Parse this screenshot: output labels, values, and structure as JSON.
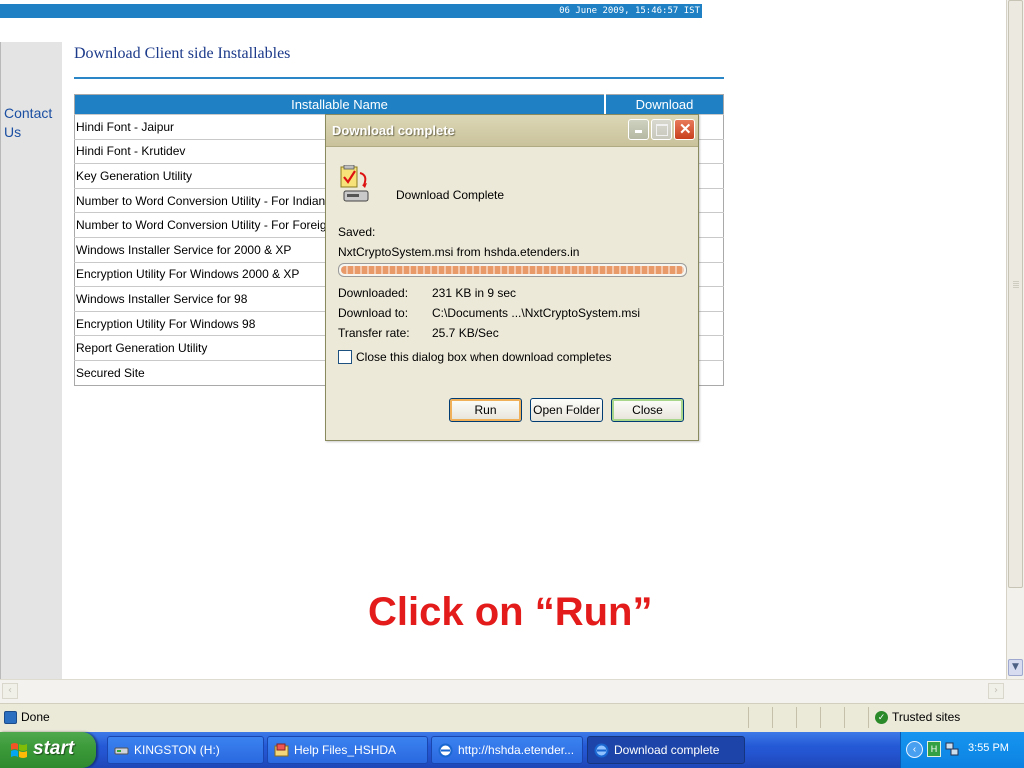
{
  "header": {
    "datetime": "06 June 2009,  15:46:57  IST"
  },
  "sidebar": {
    "contact_link": "Contact Us"
  },
  "page": {
    "title": "Download Client side Installables"
  },
  "table": {
    "columns": [
      "Installable Name",
      "Download"
    ],
    "rows": [
      "Hindi Font - Jaipur",
      "Hindi Font - Krutidev",
      "Key Generation Utility",
      "Number to Word Conversion Utility - For Indian Curr",
      "Number to Word Conversion Utility - For Foreign Cur",
      "Windows Installer Service for 2000 & XP",
      "Encryption Utility For Windows 2000 & XP",
      "Windows Installer Service for 98",
      "Encryption Utility For Windows 98",
      "Report Generation Utility",
      "Secured Site"
    ]
  },
  "dialog": {
    "title": "Download complete",
    "heading": "Download Complete",
    "saved_label": "Saved:",
    "saved_value": "NxtCryptoSystem.msi from hshda.etenders.in",
    "progress": 1.0,
    "downloaded_label": "Downloaded:",
    "downloaded_value": "231 KB in 9 sec",
    "download_to_label": "Download to:",
    "download_to_value": "C:\\Documents ...\\NxtCryptoSystem.msi",
    "transfer_rate_label": "Transfer rate:",
    "transfer_rate_value": "25.7 KB/Sec",
    "checkbox_label": "Close this dialog box when download completes",
    "checkbox_checked": false,
    "buttons": {
      "run": "Run",
      "open_folder": "Open Folder",
      "close": "Close"
    }
  },
  "annotation": "Click on “Run”",
  "statusbar": {
    "status": "Done",
    "zone": "Trusted sites"
  },
  "taskbar": {
    "start_label": "start",
    "tasks": [
      {
        "label": "KINGSTON (H:)",
        "icon": "drive-icon"
      },
      {
        "label": "Help Files_HSHDA",
        "icon": "folder-icon"
      },
      {
        "label": "http://hshda.etender...",
        "icon": "ie-icon"
      },
      {
        "label": "Download complete",
        "icon": "ie-icon",
        "active": true
      }
    ],
    "clock": "3:55 PM"
  },
  "colors": {
    "header_blue": "#1f80c4",
    "title_navy": "#1c3a8a",
    "annotation_red": "#e31b1b",
    "xp_taskbar": "#2459d6",
    "xp_start_green": "#3c9a3a"
  }
}
